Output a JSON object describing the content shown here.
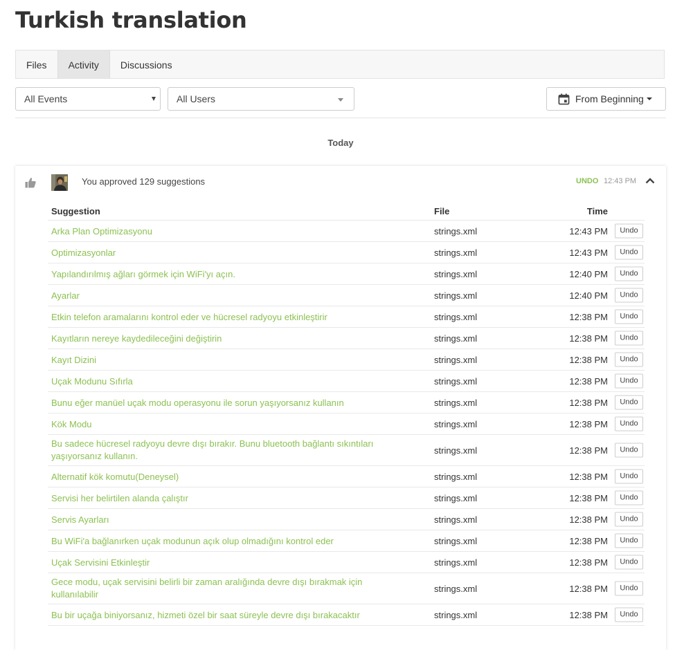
{
  "page": {
    "title": "Turkish translation"
  },
  "tabs": [
    {
      "label": "Files",
      "active": false
    },
    {
      "label": "Activity",
      "active": true
    },
    {
      "label": "Discussions",
      "active": false
    }
  ],
  "filters": {
    "events_selected": "All Events",
    "users_selected": "All Users",
    "date_range_label": "From Beginning"
  },
  "timeline": {
    "day_label": "Today",
    "event": {
      "summary": "You approved 129 suggestions",
      "undo_label": "UNDO",
      "time": "12:43 PM",
      "columns": {
        "suggestion": "Suggestion",
        "file": "File",
        "time": "Time"
      },
      "rows": [
        {
          "suggestion": "Arka Plan Optimizasyonu",
          "file": "strings.xml",
          "time": "12:43 PM",
          "undo": "Undo"
        },
        {
          "suggestion": "Optimizasyonlar",
          "file": "strings.xml",
          "time": "12:43 PM",
          "undo": "Undo"
        },
        {
          "suggestion": "Yapılandırılmış ağları görmek için WiFi'yı açın.",
          "file": "strings.xml",
          "time": "12:40 PM",
          "undo": "Undo"
        },
        {
          "suggestion": "Ayarlar",
          "file": "strings.xml",
          "time": "12:40 PM",
          "undo": "Undo"
        },
        {
          "suggestion": "Etkin telefon aramalarını kontrol eder ve hücresel radyoyu etkinleştirir",
          "file": "strings.xml",
          "time": "12:38 PM",
          "undo": "Undo"
        },
        {
          "suggestion": "Kayıtların nereye kaydedileceğini değiştirin",
          "file": "strings.xml",
          "time": "12:38 PM",
          "undo": "Undo"
        },
        {
          "suggestion": "Kayıt Dizini",
          "file": "strings.xml",
          "time": "12:38 PM",
          "undo": "Undo"
        },
        {
          "suggestion": "Uçak Modunu Sıfırla",
          "file": "strings.xml",
          "time": "12:38 PM",
          "undo": "Undo"
        },
        {
          "suggestion": "Bunu eğer manüel uçak modu operasyonu ile sorun yaşıyorsanız kullanın",
          "file": "strings.xml",
          "time": "12:38 PM",
          "undo": "Undo"
        },
        {
          "suggestion": "Kök Modu",
          "file": "strings.xml",
          "time": "12:38 PM",
          "undo": "Undo"
        },
        {
          "suggestion": "Bu sadece hücresel radyoyu devre dışı bırakır. Bunu bluetooth bağlantı sıkıntıları yaşıyorsanız kullanın.",
          "file": "strings.xml",
          "time": "12:38 PM",
          "undo": "Undo",
          "tall": true
        },
        {
          "suggestion": "Alternatif kök komutu(Deneysel)",
          "file": "strings.xml",
          "time": "12:38 PM",
          "undo": "Undo"
        },
        {
          "suggestion": "Servisi her belirtilen alanda çalıştır",
          "file": "strings.xml",
          "time": "12:38 PM",
          "undo": "Undo"
        },
        {
          "suggestion": "Servis Ayarları",
          "file": "strings.xml",
          "time": "12:38 PM",
          "undo": "Undo"
        },
        {
          "suggestion": "Bu WiFi'a bağlanırken uçak modunun açık olup olmadığını kontrol eder",
          "file": "strings.xml",
          "time": "12:38 PM",
          "undo": "Undo"
        },
        {
          "suggestion": "Uçak Servisini Etkinleştir",
          "file": "strings.xml",
          "time": "12:38 PM",
          "undo": "Undo"
        },
        {
          "suggestion": "Gece modu, uçak servisini belirli bir zaman aralığında devre dışı bırakmak için kullanılabilir",
          "file": "strings.xml",
          "time": "12:38 PM",
          "undo": "Undo",
          "tall": true
        },
        {
          "suggestion": "Bu bir uçağa biniyorsanız, hizmeti özel bir saat süreyle devre dışı bırakacaktır",
          "file": "strings.xml",
          "time": "12:38 PM",
          "undo": "Undo"
        }
      ]
    }
  },
  "colors": {
    "accent": "#8cc152",
    "text": "#333333",
    "border": "#cccccc"
  },
  "icons": {
    "event_type": "thumbs-up-icon",
    "date": "calendar-icon",
    "collapse": "chevron-up-icon"
  }
}
